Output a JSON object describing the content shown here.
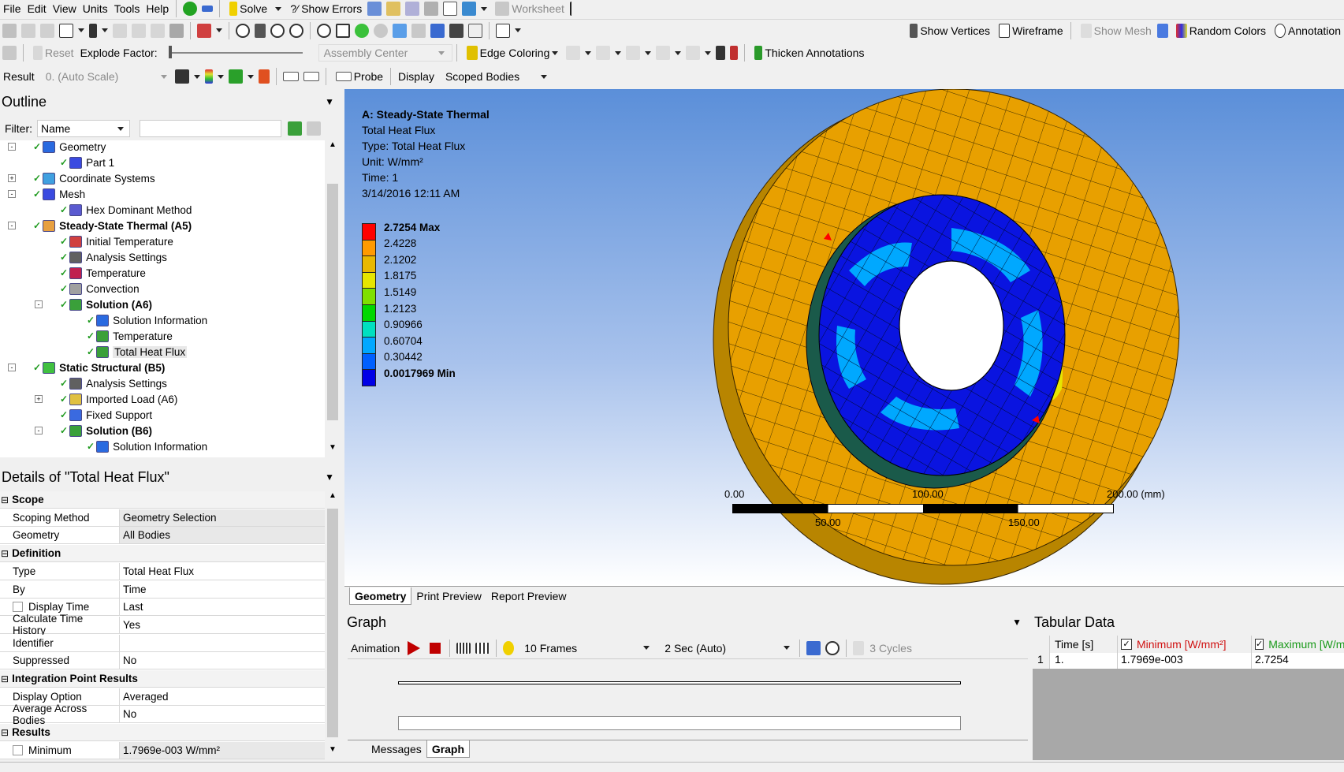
{
  "menu": [
    "File",
    "Edit",
    "View",
    "Units",
    "Tools",
    "Help"
  ],
  "toolbar1": {
    "solve": "Solve",
    "show_errors": "?⁄ Show Errors",
    "worksheet": "Worksheet"
  },
  "toolbar2": {
    "show_vertices": "Show Vertices",
    "wireframe": "Wireframe",
    "show_mesh": "Show Mesh",
    "random_colors": "Random Colors",
    "annotation": "Annotation"
  },
  "toolbar3": {
    "reset": "Reset",
    "explode_factor": "Explode Factor:",
    "assembly_center": "Assembly Center",
    "edge_coloring": "Edge Coloring",
    "thicken_annotations": "Thicken Annotations"
  },
  "toolbar4": {
    "result": "Result",
    "scale": "0. (Auto Scale)",
    "probe": "Probe",
    "display": "Display",
    "scoped_bodies": "Scoped Bodies"
  },
  "outline": {
    "title": "Outline",
    "filter_label": "Filter:",
    "filter_value": "Name",
    "items": [
      {
        "label": "Geometry",
        "depth": 1,
        "bold": false,
        "exp": "-"
      },
      {
        "label": "Part 1",
        "depth": 2,
        "bold": false,
        "exp": ""
      },
      {
        "label": "Coordinate Systems",
        "depth": 1,
        "bold": false,
        "exp": "+"
      },
      {
        "label": "Mesh",
        "depth": 1,
        "bold": false,
        "exp": "-"
      },
      {
        "label": "Hex Dominant Method",
        "depth": 2,
        "bold": false,
        "exp": ""
      },
      {
        "label": "Steady-State Thermal (A5)",
        "depth": 1,
        "bold": true,
        "exp": "-"
      },
      {
        "label": "Initial Temperature",
        "depth": 2,
        "bold": false,
        "exp": ""
      },
      {
        "label": "Analysis Settings",
        "depth": 2,
        "bold": false,
        "exp": ""
      },
      {
        "label": "Temperature",
        "depth": 2,
        "bold": false,
        "exp": ""
      },
      {
        "label": "Convection",
        "depth": 2,
        "bold": false,
        "exp": ""
      },
      {
        "label": "Solution (A6)",
        "depth": 2,
        "bold": true,
        "exp": "-"
      },
      {
        "label": "Solution Information",
        "depth": 3,
        "bold": false,
        "exp": ""
      },
      {
        "label": "Temperature",
        "depth": 3,
        "bold": false,
        "exp": ""
      },
      {
        "label": "Total Heat Flux",
        "depth": 3,
        "bold": false,
        "exp": "",
        "selected": true
      },
      {
        "label": "Static Structural (B5)",
        "depth": 1,
        "bold": true,
        "exp": "-"
      },
      {
        "label": "Analysis Settings",
        "depth": 2,
        "bold": false,
        "exp": ""
      },
      {
        "label": "Imported Load (A6)",
        "depth": 2,
        "bold": false,
        "exp": "+"
      },
      {
        "label": "Fixed Support",
        "depth": 2,
        "bold": false,
        "exp": ""
      },
      {
        "label": "Solution (B6)",
        "depth": 2,
        "bold": true,
        "exp": "-"
      },
      {
        "label": "Solution Information",
        "depth": 3,
        "bold": false,
        "exp": ""
      }
    ]
  },
  "details": {
    "title": "Details of \"Total Heat Flux\"",
    "rows": [
      {
        "section": "Scope"
      },
      {
        "k": "Scoping Method",
        "v": "Geometry Selection",
        "grey": true
      },
      {
        "k": "Geometry",
        "v": "All Bodies",
        "grey": true
      },
      {
        "section": "Definition"
      },
      {
        "k": "Type",
        "v": "Total Heat Flux"
      },
      {
        "k": "By",
        "v": "Time"
      },
      {
        "k": "Display Time",
        "v": "Last",
        "check": true
      },
      {
        "k": "Calculate Time History",
        "v": "Yes"
      },
      {
        "k": "Identifier",
        "v": ""
      },
      {
        "k": "Suppressed",
        "v": "No"
      },
      {
        "section": "Integration Point Results"
      },
      {
        "k": "Display Option",
        "v": "Averaged"
      },
      {
        "k": "Average Across Bodies",
        "v": "No"
      },
      {
        "section": "Results"
      },
      {
        "k": "Minimum",
        "v": "1.7969e-003 W/mm²",
        "check": true,
        "grey": true
      }
    ]
  },
  "viewport": {
    "title": "A: Steady-State Thermal",
    "lines": [
      "Total Heat Flux",
      "Type: Total Heat Flux",
      "Unit: W/mm²",
      "Time: 1",
      "3/14/2016 12:11 AM"
    ],
    "legend": [
      {
        "label": "2.7254 Max",
        "color": "#ff0000",
        "bold": true
      },
      {
        "label": "2.4228",
        "color": "#ff9a00"
      },
      {
        "label": "2.1202",
        "color": "#e8b800"
      },
      {
        "label": "1.8175",
        "color": "#e6e600"
      },
      {
        "label": "1.5149",
        "color": "#7fe000"
      },
      {
        "label": "1.2123",
        "color": "#00d800"
      },
      {
        "label": "0.90966",
        "color": "#00e0c0"
      },
      {
        "label": "0.60704",
        "color": "#00a8ff"
      },
      {
        "label": "0.30442",
        "color": "#0060ff"
      },
      {
        "label": "0.0017969 Min",
        "color": "#0000e6",
        "bold": true
      }
    ],
    "scale": {
      "t0": "0.00",
      "t1": "50.00",
      "t2": "100.00",
      "t3": "150.00",
      "t4": "200.00 (mm)"
    },
    "tabs": [
      "Geometry",
      "Print Preview",
      "Report Preview"
    ]
  },
  "graph": {
    "title": "Graph",
    "animation": "Animation",
    "frames": "10 Frames",
    "speed": "2 Sec (Auto)",
    "cycles": "3 Cycles",
    "tabs": [
      "Messages",
      "Graph"
    ]
  },
  "tabular": {
    "title": "Tabular Data",
    "headers": [
      "Time [s]",
      "Minimum [W/mm²]",
      "Maximum [W/mm"
    ],
    "row": [
      "1",
      "1.",
      "1.7969e-003",
      "2.7254"
    ]
  },
  "colors": {
    "viewport_top": "#5b8fd9",
    "viewport_bottom": "#ffffff",
    "disc_orange": "#e8a000",
    "hub_blue": "#0a14e0"
  }
}
